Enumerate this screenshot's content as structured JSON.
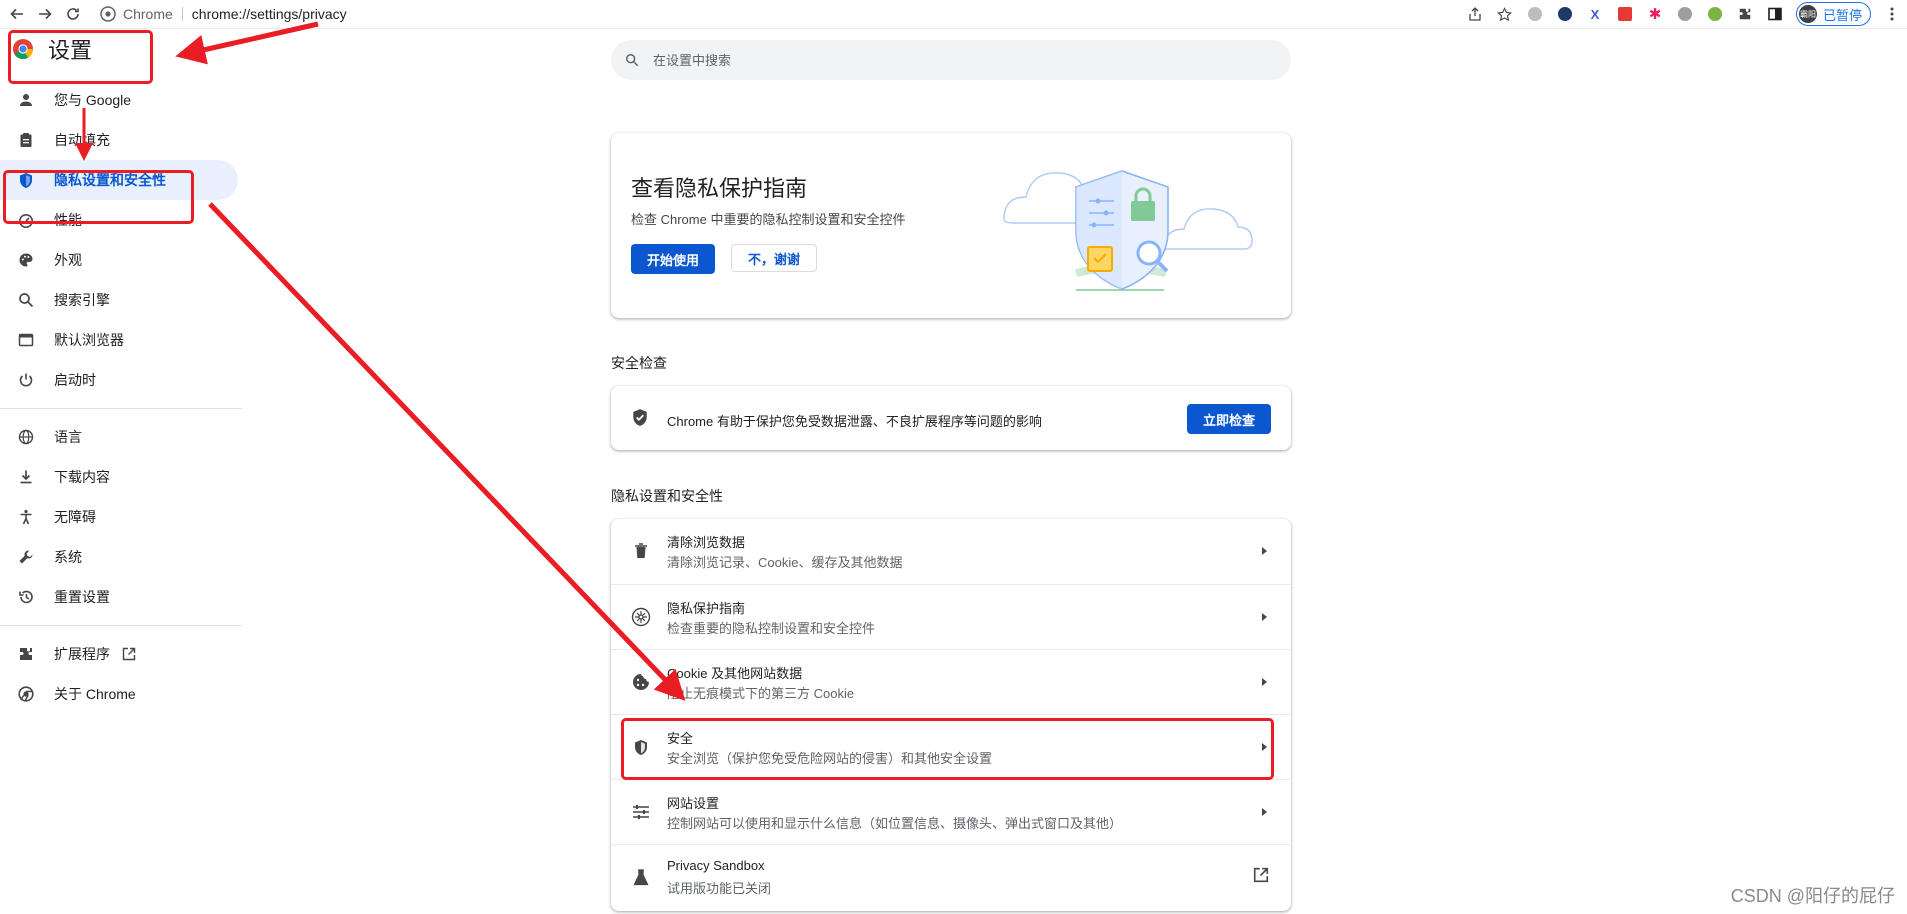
{
  "toolbar": {
    "site_name": "Chrome",
    "url": "chrome://settings/privacy",
    "profile_avatar_text": "霸阳",
    "profile_status": "已暂停"
  },
  "app": {
    "title": "设置"
  },
  "search": {
    "placeholder": "在设置中搜索"
  },
  "sidebar": {
    "items": [
      {
        "label": "您与 Google",
        "icon": "person-icon"
      },
      {
        "label": "自动填充",
        "icon": "clipboard-icon"
      },
      {
        "label": "隐私设置和安全性",
        "icon": "shield-icon",
        "active": true
      },
      {
        "label": "性能",
        "icon": "speedometer-icon"
      },
      {
        "label": "外观",
        "icon": "palette-icon"
      },
      {
        "label": "搜索引擎",
        "icon": "search-icon"
      },
      {
        "label": "默认浏览器",
        "icon": "browser-icon"
      },
      {
        "label": "启动时",
        "icon": "power-icon"
      },
      {
        "label": "语言",
        "icon": "globe-icon"
      },
      {
        "label": "下载内容",
        "icon": "download-icon"
      },
      {
        "label": "无障碍",
        "icon": "accessibility-icon"
      },
      {
        "label": "系统",
        "icon": "wrench-icon"
      },
      {
        "label": "重置设置",
        "icon": "history-icon"
      },
      {
        "label": "扩展程序",
        "icon": "puzzle-icon"
      },
      {
        "label": "关于 Chrome",
        "icon": "chrome-icon"
      }
    ]
  },
  "promo": {
    "title": "查看隐私保护指南",
    "subtitle": "检查 Chrome 中重要的隐私控制设置和安全控件",
    "primary_button": "开始使用",
    "secondary_button": "不，谢谢"
  },
  "safety_check": {
    "section_title": "安全检查",
    "text": "Chrome 有助于保护您免受数据泄露、不良扩展程序等问题的影响",
    "button": "立即检查"
  },
  "privacy": {
    "section_title": "隐私设置和安全性",
    "rows": [
      {
        "title": "清除浏览数据",
        "subtitle": "清除浏览记录、Cookie、缓存及其他数据",
        "icon": "trash-icon"
      },
      {
        "title": "隐私保护指南",
        "subtitle": "检查重要的隐私控制设置和安全控件",
        "icon": "compass-icon"
      },
      {
        "title": "Cookie 及其他网站数据",
        "subtitle": "阻止无痕模式下的第三方 Cookie",
        "icon": "cookie-icon"
      },
      {
        "title": "安全",
        "subtitle": "安全浏览（保护您免受危险网站的侵害）和其他安全设置",
        "icon": "security-shield-icon"
      },
      {
        "title": "网站设置",
        "subtitle": "控制网站可以使用和显示什么信息（如位置信息、摄像头、弹出式窗口及其他）",
        "icon": "sliders-icon"
      },
      {
        "title": "Privacy Sandbox",
        "subtitle": "试用版功能已关闭",
        "icon": "flask-icon"
      }
    ]
  },
  "watermark": "CSDN @阳仔的屁仔",
  "colors": {
    "accent": "#0b57d0",
    "annotation": "#ea1c24",
    "active_bg": "#e8f0fe"
  }
}
